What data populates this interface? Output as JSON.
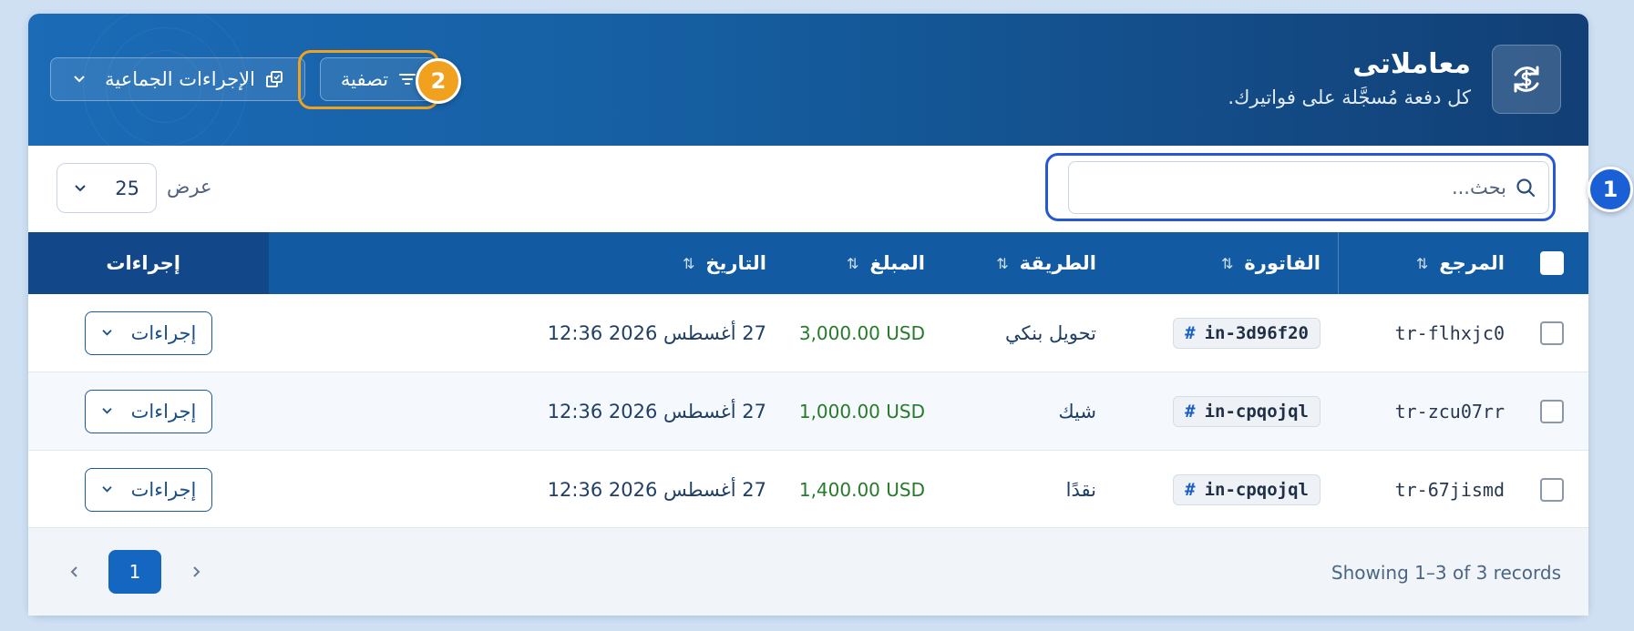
{
  "header": {
    "title": "معاملاتى",
    "subtitle": "كل دفعة مُسجَّلة على فواتيرك.",
    "bulk_actions_label": "الإجراءات الجماعية",
    "filter_label": "تصفية"
  },
  "annotations": {
    "badge_1": "1",
    "badge_2": "2"
  },
  "toolbar": {
    "search_placeholder": "بحث...",
    "show_label": "عرض",
    "page_size": "25"
  },
  "table": {
    "columns": {
      "reference": "المرجع",
      "invoice": "الفاتورة",
      "method": "الطريقة",
      "amount": "المبلغ",
      "date": "التاريخ",
      "actions": "إجراءات"
    },
    "rows": [
      {
        "reference": "tr-flhxjc0",
        "invoice": "in-3d96f20",
        "method": "تحويل بنكي",
        "amount": "3,000.00 USD",
        "date": "27 أغسطس 2026 12:36",
        "action": "إجراءات"
      },
      {
        "reference": "tr-zcu07rr",
        "invoice": "in-cpqojql",
        "method": "شيك",
        "amount": "1,000.00 USD",
        "date": "27 أغسطس 2026 12:36",
        "action": "إجراءات"
      },
      {
        "reference": "tr-67jismd",
        "invoice": "in-cpqojql",
        "method": "نقدًا",
        "amount": "1,400.00 USD",
        "date": "27 أغسطس 2026 12:36",
        "action": "إجراءات"
      }
    ]
  },
  "footer": {
    "showing": "Showing 1–3 of 3 records",
    "current_page": "1"
  },
  "colors": {
    "header_dark": "#123f75",
    "header_light": "#1b6bb7",
    "accent_blue": "#1566c0",
    "highlight_orange": "#f0a21f",
    "highlight_blue": "#2458d6",
    "amount_green": "#267a2a"
  }
}
